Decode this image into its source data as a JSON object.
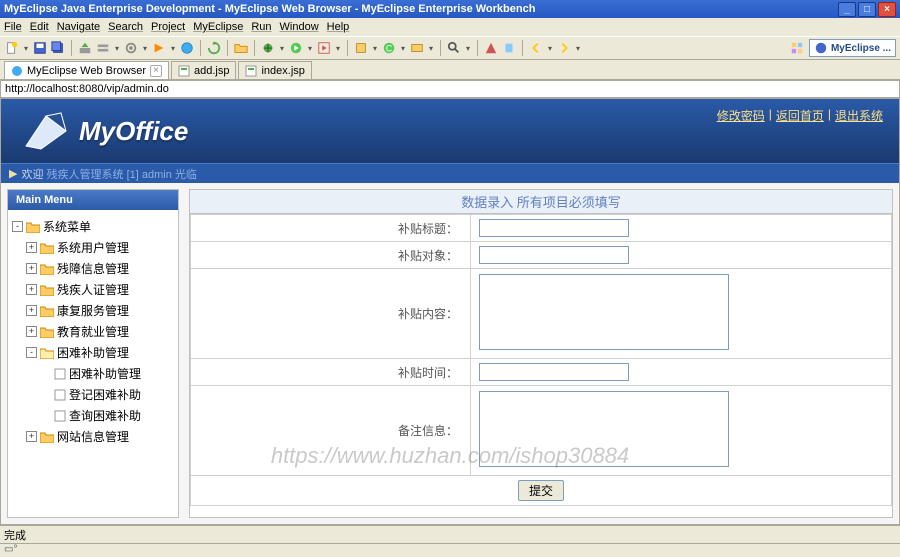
{
  "window": {
    "title": "MyEclipse Java Enterprise Development - MyEclipse Web Browser - MyEclipse Enterprise Workbench",
    "minimize": "_",
    "maximize": "□",
    "close": "×"
  },
  "menubar": [
    "File",
    "Edit",
    "Navigate",
    "Search",
    "Project",
    "MyEclipse",
    "Run",
    "Window",
    "Help"
  ],
  "tabbar": {
    "tabs": [
      {
        "label": "MyEclipse Web Browser",
        "active": true,
        "closable": true
      },
      {
        "label": "add.jsp",
        "active": false,
        "closable": false
      },
      {
        "label": "index.jsp",
        "active": false,
        "closable": false
      }
    ]
  },
  "perspective_label": "MyEclipse ...",
  "addressbar": "http://localhost:8080/vip/admin.do",
  "banner": {
    "logo_text": "MyOffice",
    "links": [
      "修改密码",
      "返回首页",
      "退出系统"
    ],
    "sep": "|"
  },
  "welcome": {
    "prefix": "欢迎",
    "text": "残疾人管理系统 [1] admin 光临"
  },
  "sidebar": {
    "header": "Main Menu",
    "root": {
      "tog": "-",
      "label": "系统菜单"
    },
    "items": [
      {
        "tog": "+",
        "label": "系统用户管理"
      },
      {
        "tog": "+",
        "label": "残障信息管理"
      },
      {
        "tog": "+",
        "label": "残疾人证管理"
      },
      {
        "tog": "+",
        "label": "康复服务管理"
      },
      {
        "tog": "+",
        "label": "教育就业管理"
      },
      {
        "tog": "-",
        "label": "困难补助管理"
      }
    ],
    "subitems": [
      {
        "label": "困难补助管理"
      },
      {
        "label": "登记困难补助"
      },
      {
        "label": "查询困难补助"
      }
    ],
    "last": {
      "tog": "+",
      "label": "网站信息管理"
    }
  },
  "form": {
    "header": "数据录入 所有项目必须填写",
    "fields": {
      "title_label": "补贴标题：",
      "target_label": "补贴对象：",
      "content_label": "补贴内容：",
      "time_label": "补贴时间：",
      "remark_label": "备注信息："
    },
    "submit": "提交"
  },
  "watermark": "https://www.huzhan.com/ishop30884",
  "statusbar": "完成"
}
